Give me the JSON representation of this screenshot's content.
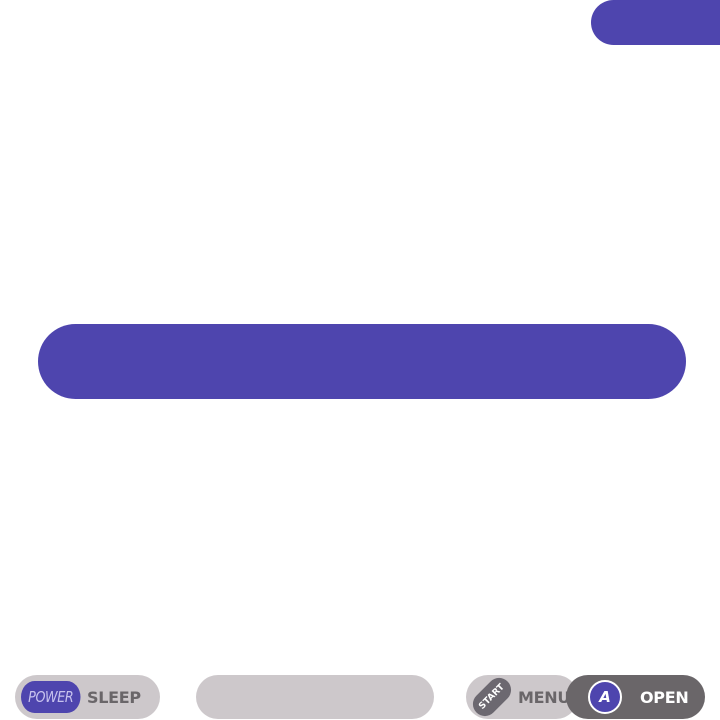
{
  "colors": {
    "accent": "#4e45ae",
    "background": "#ffffff",
    "hint_pill": "#cdc8cb",
    "hint_pill_dark": "#6a6669",
    "hint_text": "#6a6669"
  },
  "hints": {
    "power_key": "POWER",
    "power_action": "SLEEP",
    "start_key": "START",
    "start_action": "MENU",
    "a_key": "A",
    "a_action": "OPEN"
  }
}
